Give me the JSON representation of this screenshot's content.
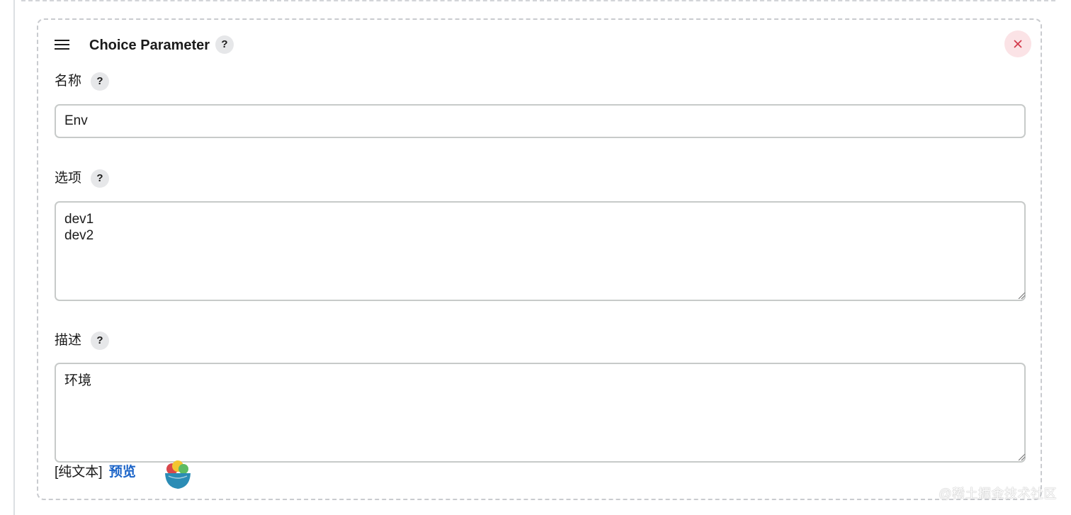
{
  "card": {
    "title": "Choice Parameter",
    "help_glyph": "?",
    "close_icon": "close-icon",
    "drag_icon": "hamburger-icon"
  },
  "fields": {
    "name": {
      "label": "名称",
      "value": "Env"
    },
    "choices": {
      "label": "选项",
      "value": "dev1\ndev2"
    },
    "description": {
      "label": "描述",
      "value": "环境"
    }
  },
  "footer": {
    "plain_text_label": "[纯文本]",
    "preview_link": "预览"
  },
  "watermark": "@稀土掘金技术社区",
  "colors": {
    "link": "#1b64c8",
    "close_bg": "#fbe3e6",
    "close_x": "#d33a4c",
    "help_bg": "#e6e7e9",
    "border": "#c7cac9"
  }
}
